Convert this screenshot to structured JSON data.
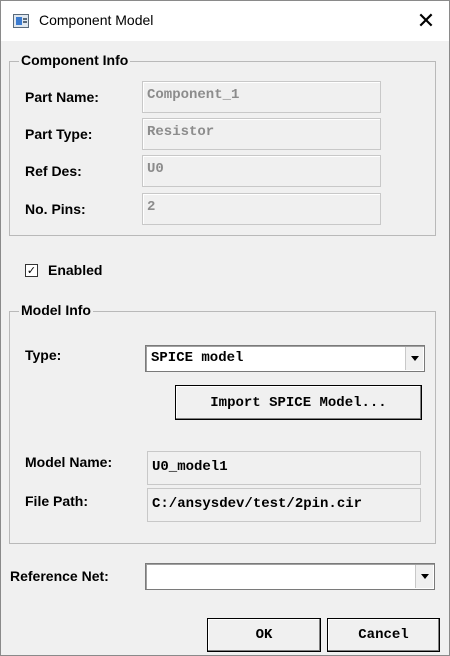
{
  "window": {
    "title": "Component Model"
  },
  "component_info": {
    "legend": "Component Info",
    "part_name_label": "Part Name:",
    "part_name_value": "Component_1",
    "part_type_label": "Part Type:",
    "part_type_value": "Resistor",
    "ref_des_label": "Ref Des:",
    "ref_des_value": "U0",
    "no_pins_label": "No. Pins:",
    "no_pins_value": "2"
  },
  "enabled": {
    "label": "Enabled",
    "checked": true,
    "mark": "✓"
  },
  "model_info": {
    "legend": "Model Info",
    "type_label": "Type:",
    "type_value": "SPICE model",
    "import_button": "Import SPICE Model...",
    "model_name_label": "Model Name:",
    "model_name_value": "U0_model1",
    "file_path_label": "File Path:",
    "file_path_value": "C:/ansysdev/test/2pin.cir"
  },
  "reference_net": {
    "label": "Reference Net:",
    "value": ""
  },
  "buttons": {
    "ok": "OK",
    "cancel": "Cancel"
  },
  "icons": {
    "app": "app-window-icon",
    "close": "close-icon",
    "dropdown": "chevron-down-icon"
  }
}
